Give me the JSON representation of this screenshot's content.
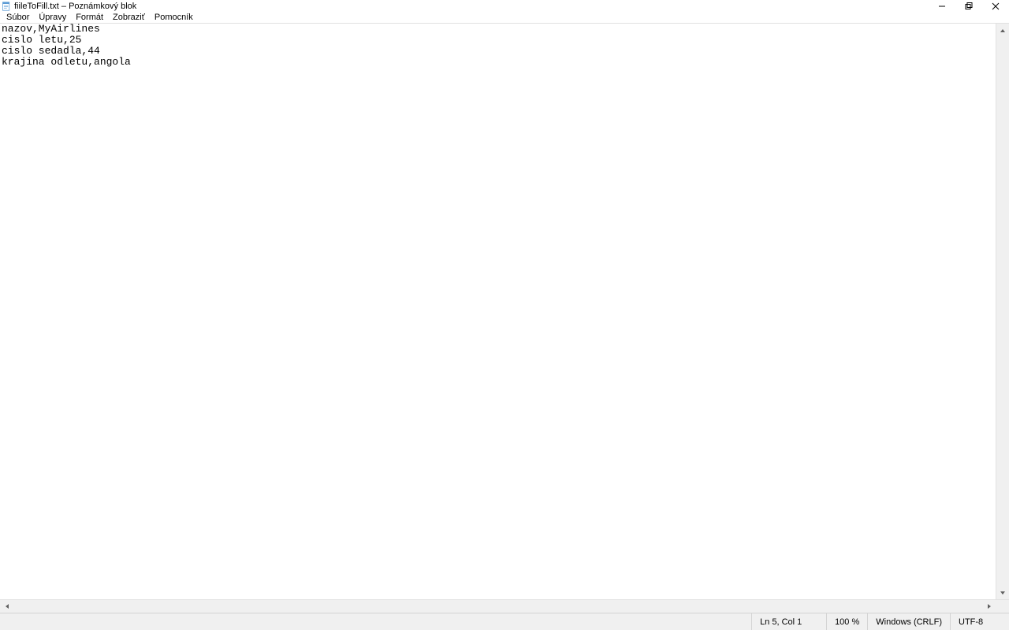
{
  "window": {
    "title": "fiileToFill.txt – Poznámkový blok"
  },
  "menu": {
    "items": [
      "Súbor",
      "Úpravy",
      "Formát",
      "Zobraziť",
      "Pomocník"
    ]
  },
  "content": {
    "text": "nazov,MyAirlines\ncislo letu,25\ncislo sedadla,44\nkrajina odletu,angola\n"
  },
  "status": {
    "position": "Ln 5, Col 1",
    "zoom": "100 %",
    "eol": "Windows (CRLF)",
    "encoding": "UTF-8"
  }
}
